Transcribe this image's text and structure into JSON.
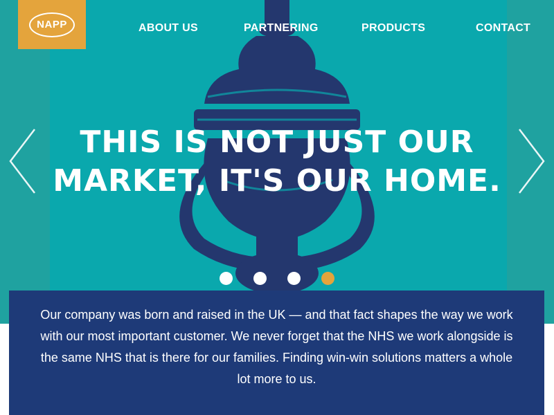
{
  "brand": {
    "logo_text": "NAPP",
    "accent": "#e4a43c",
    "hero_bg": "#0aa8ad",
    "side_bg": "#1fa2a0",
    "dark_blue": "#1e3a78"
  },
  "nav": {
    "about": "ABOUT US",
    "partnering": "PARTNERING",
    "products": "PRODUCTS",
    "contact": "CONTACT"
  },
  "hero": {
    "headline_line1": "THIS IS NOT JUST OUR",
    "headline_line2": "MARKET, IT'S OUR HOME.",
    "prev_icon": "chevron-left-icon",
    "next_icon": "chevron-right-icon",
    "background_image": "door-knocker-illustration",
    "slides_total": 4,
    "active_slide": 4
  },
  "about": {
    "text": "Our company was born and raised in the UK — and that fact shapes the way we work with our most important customer. We never forget that the NHS we work alongside is the same NHS that is there for our families. Finding win-win solutions matters a whole lot more to us."
  }
}
